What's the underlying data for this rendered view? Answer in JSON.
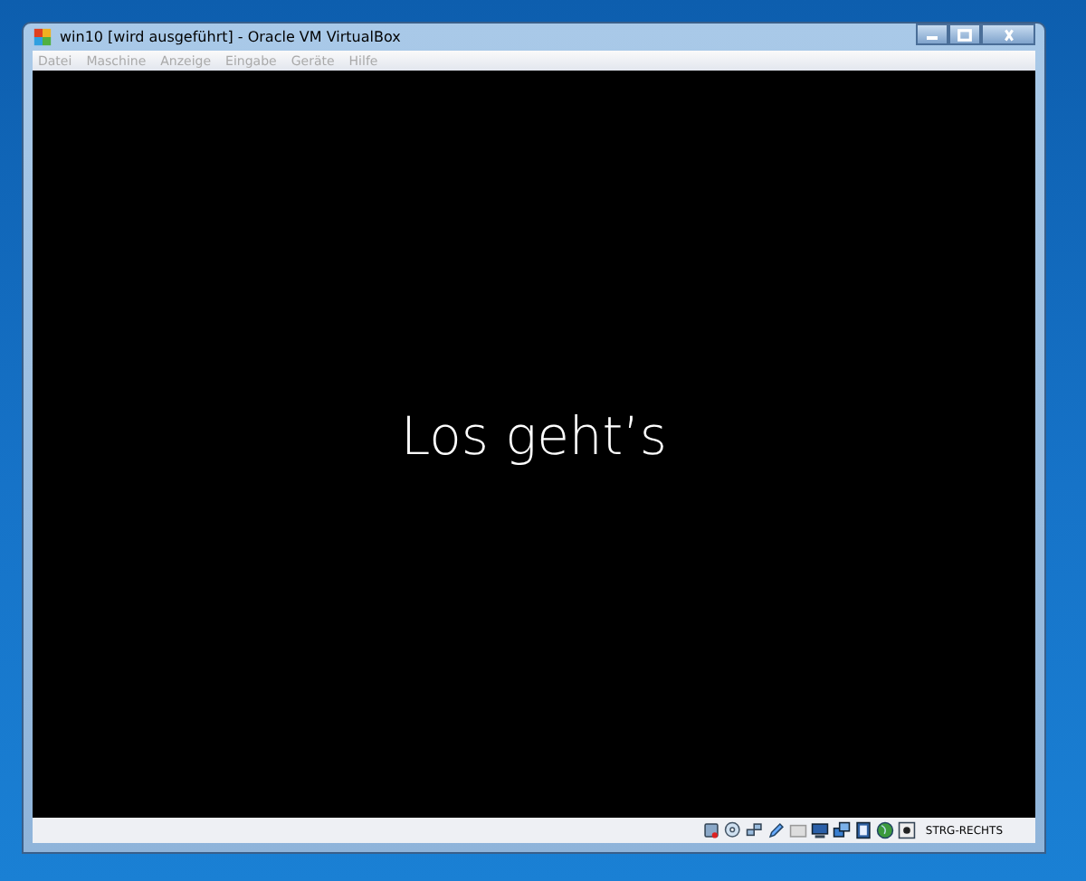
{
  "window": {
    "title": "win10 [wird ausgeführt] - Oracle VM VirtualBox"
  },
  "menu": [
    {
      "label": "Datei",
      "disabled": true
    },
    {
      "label": "Maschine",
      "disabled": true
    },
    {
      "label": "Anzeige",
      "disabled": true
    },
    {
      "label": "Eingabe",
      "disabled": true
    },
    {
      "label": "Geräte",
      "disabled": true
    },
    {
      "label": "Hilfe",
      "disabled": true
    }
  ],
  "guest_screen": {
    "message": "Los geht’s"
  },
  "status_bar": {
    "host_key": "STRG-RECHTS"
  }
}
